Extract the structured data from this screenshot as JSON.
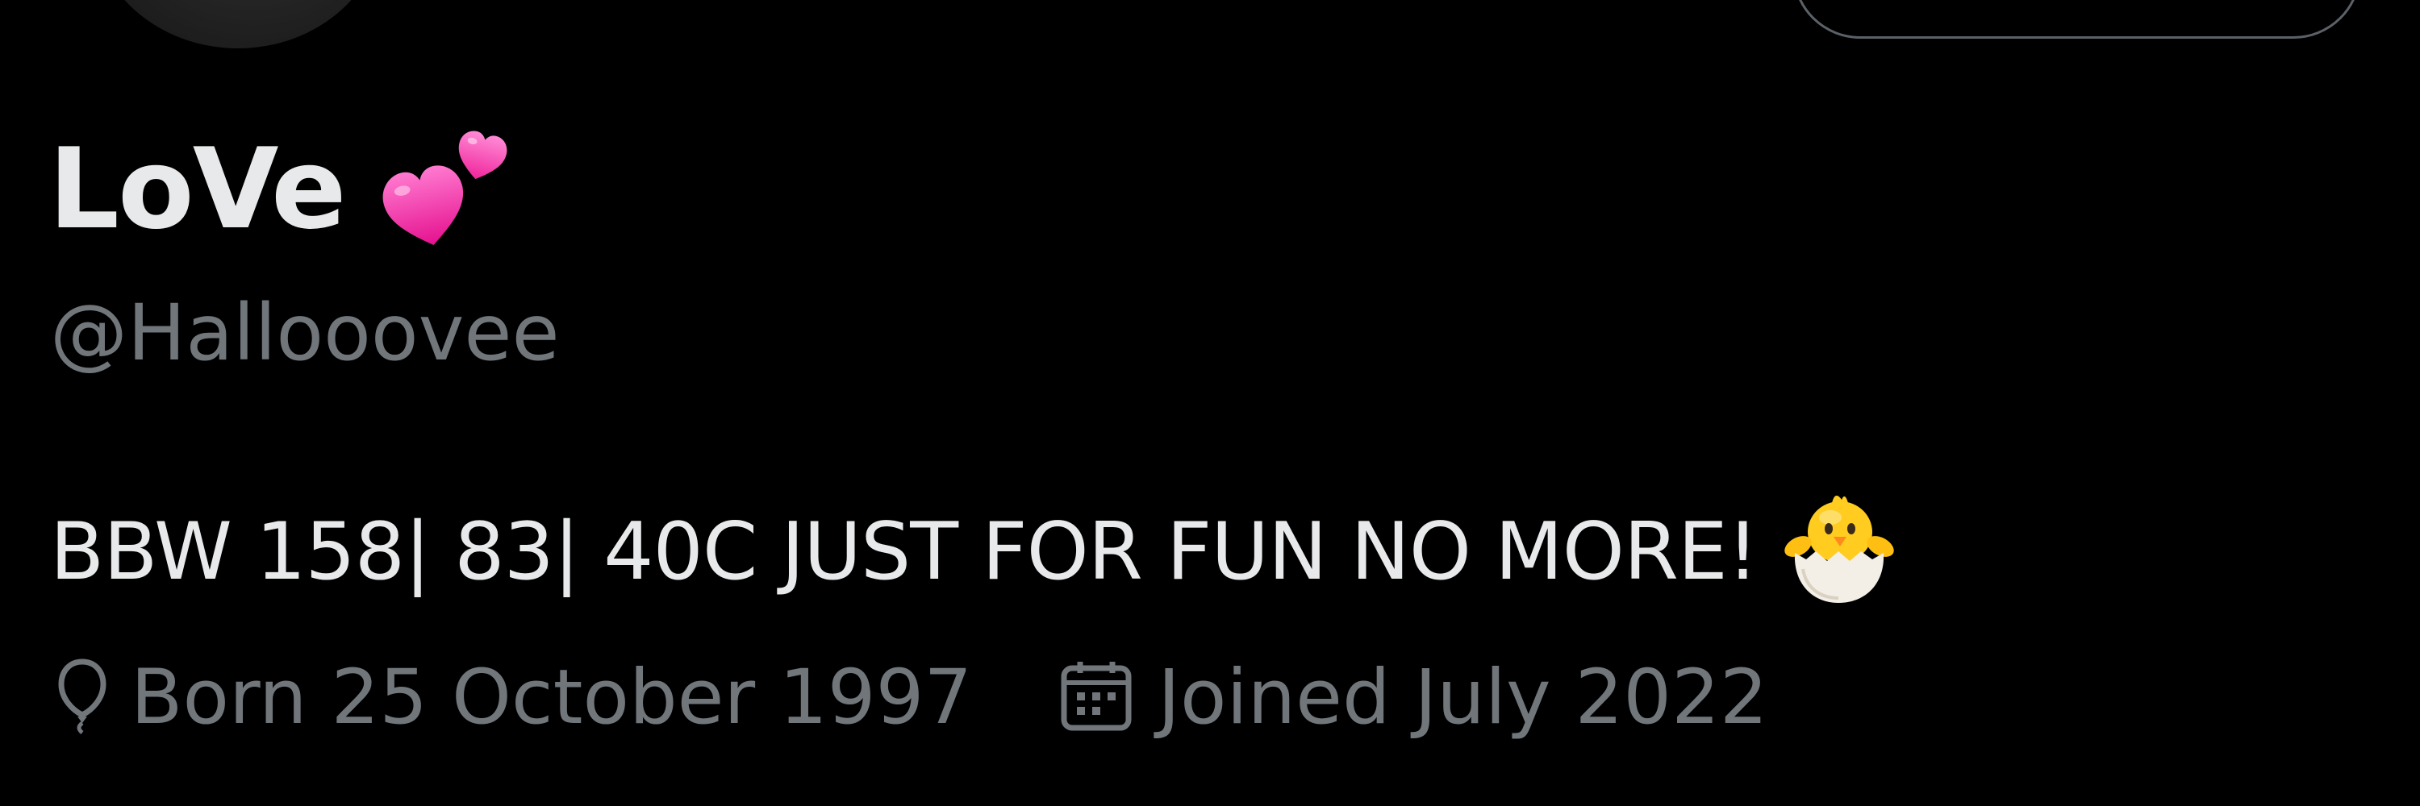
{
  "profile": {
    "display_name": "LoVe",
    "name_emoji": "two-hearts-icon",
    "handle": "@Hallooovee",
    "bio": "BBW 158| 83| 40C JUST FOR FUN NO MORE!",
    "bio_emoji": "hatching-chick-icon",
    "birthday": "Born 25 October 1997",
    "joined": "Joined July 2022"
  },
  "colors": {
    "background": "#000000",
    "primary_text": "#e7e9ea",
    "secondary_text": "#71767b",
    "heart_pink": "#ff3ea5"
  }
}
